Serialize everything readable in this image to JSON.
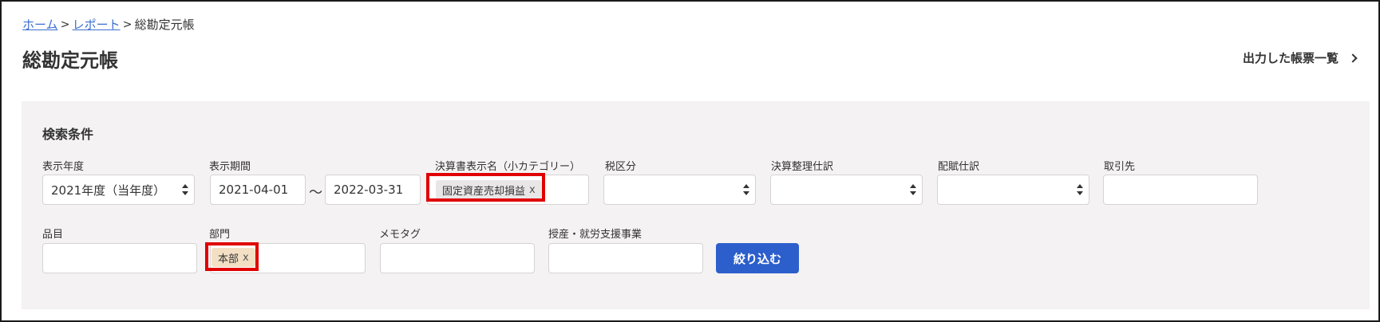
{
  "breadcrumb": {
    "home": "ホーム",
    "reports": "レポート",
    "current": "総勘定元帳",
    "separator": ">"
  },
  "page": {
    "title": "総勘定元帳",
    "report_list_link": "出力した帳票一覧"
  },
  "search": {
    "title": "検索条件",
    "fiscal_year": {
      "label": "表示年度",
      "value": "2021年度（当年度）"
    },
    "period": {
      "label": "表示期間",
      "start": "2021-04-01",
      "end": "2022-03-31",
      "separator": "〜"
    },
    "statement_name": {
      "label": "決算書表示名（小カテゴリー）",
      "tag": "固定資産売却損益",
      "tag_remove": "x"
    },
    "tax_category": {
      "label": "税区分",
      "value": ""
    },
    "closing_entry": {
      "label": "決算整理仕訳",
      "value": ""
    },
    "allocation_entry": {
      "label": "配賦仕訳",
      "value": ""
    },
    "partner": {
      "label": "取引先",
      "value": ""
    },
    "item": {
      "label": "品目",
      "value": ""
    },
    "department": {
      "label": "部門",
      "tag": "本部",
      "tag_remove": "x"
    },
    "memo_tag": {
      "label": "メモタグ",
      "value": ""
    },
    "segment": {
      "label": "授産・就労支援事業",
      "value": ""
    },
    "submit_label": "絞り込む"
  },
  "colors": {
    "primary_button": "#2c5fcc",
    "link": "#3b6fd1",
    "panel_bg": "#f4f2f2",
    "highlight": "#e00000",
    "department_tag_bg": "#f3e0c4"
  },
  "icons": {
    "breadcrumb_separator": "chevron-right-icon",
    "report_link": "chevron-right-icon",
    "select_arrow": "select-updown-icon"
  }
}
